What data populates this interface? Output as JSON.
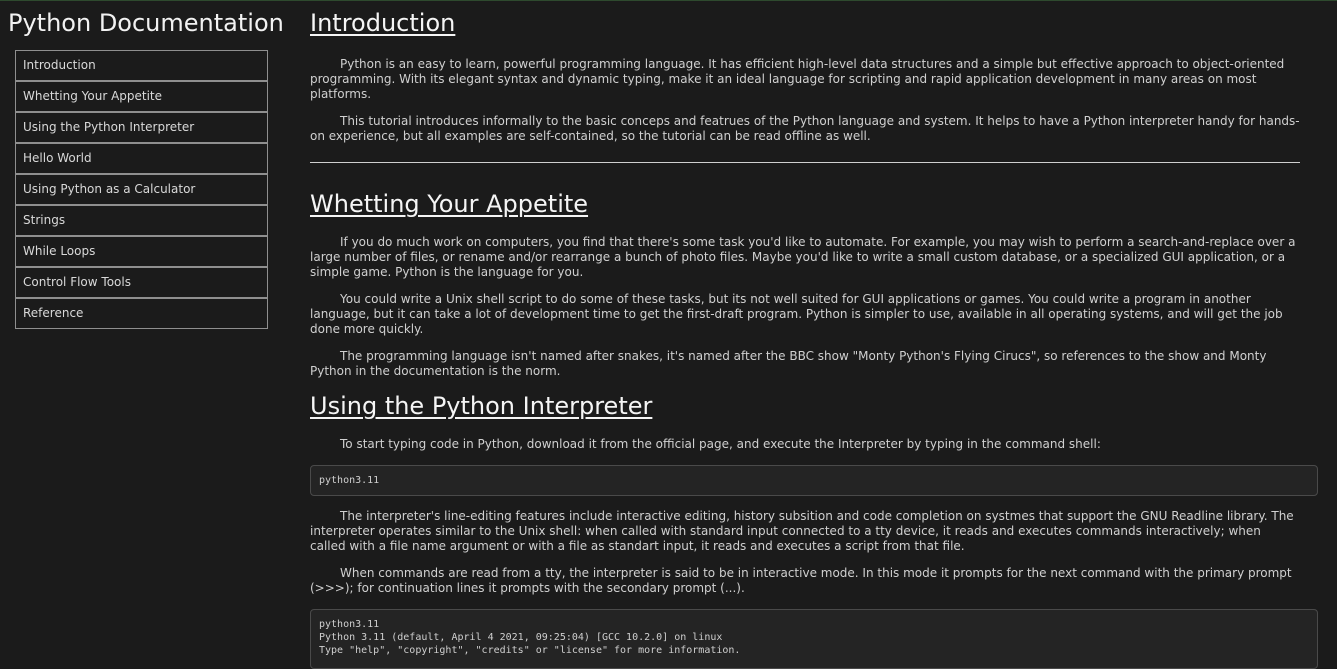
{
  "sidebar": {
    "title": "Python Documentation",
    "items": [
      {
        "label": "Introduction"
      },
      {
        "label": "Whetting Your Appetite"
      },
      {
        "label": "Using the Python Interpreter"
      },
      {
        "label": "Hello World"
      },
      {
        "label": "Using Python as a Calculator"
      },
      {
        "label": "Strings"
      },
      {
        "label": "While Loops"
      },
      {
        "label": "Control Flow Tools"
      },
      {
        "label": "Reference"
      }
    ]
  },
  "sections": {
    "introduction": {
      "title": "Introduction",
      "p1": "Python is an easy to learn, powerful programming language. It has efficient high-level data structures and a simple but effective approach to object-oriented programming. With its elegant syntax and dynamic typing, make it an ideal language for scripting and rapid application development in many areas on most platforms.",
      "p2": "This tutorial introduces informally to the basic conceps and featrues of the Python language and system. It helps to have a Python interpreter handy for hands-on experience, but all examples are self-contained, so the tutorial can be read offline as well."
    },
    "appetite": {
      "title": "Whetting Your Appetite",
      "p1": "If you do much work on computers, you find that there's some task you'd like to automate. For example, you may wish to perform a search-and-replace over a large number of files, or rename and/or rearrange a bunch of photo files. Maybe you'd like to write a small custom database, or a specialized GUI application, or a simple game. Python is the language for you.",
      "p2": "You could write a Unix shell script to do some of these tasks, but its not well suited for GUI applications or games. You could write a program in another language, but it can take a lot of development time to get the first-draft program. Python is simpler to use, available in all operating systems, and will get the job done more quickly.",
      "p3": "The programming language isn't named after snakes, it's named after the BBC show \"Monty Python's Flying Cirucs\", so references to the show and Monty Python in the documentation is the norm."
    },
    "interpreter": {
      "title": "Using the Python Interpreter",
      "p1": "To start typing code in Python, download it from the official page, and execute the Interpreter by typing in the command shell:",
      "code1": "python3.11",
      "p2": "The interpreter's line-editing features include interactive editing, history subsition and code completion on systmes that support the GNU Readline library. The interpreter operates similar to the Unix shell: when called with standard input connected to a tty device, it reads and executes commands interactively; when called with a file name argument or with a file as standart input, it reads and executes a script from that file.",
      "p3": "When commands are read from a tty, the interpreter is said to be in interactive mode. In this mode it prompts for the next command with the primary prompt (>>>); for continuation lines it prompts with the secondary prompt (...).",
      "code2": "python3.11\nPython 3.11 (default, April 4 2021, 09:25:04) [GCC 10.2.0] on linux\nType \"help\", \"copyright\", \"credits\" or \"license\" for more information."
    }
  }
}
